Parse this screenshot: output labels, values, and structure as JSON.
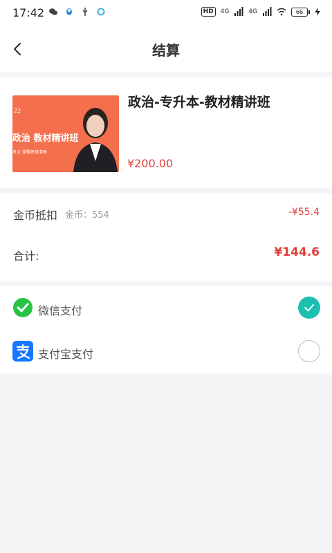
{
  "statusbar": {
    "time": "17:42",
    "left_icons": [
      "wechat-icon",
      "qq-icon",
      "usb-icon",
      "sync-icon"
    ],
    "hd_label": "HD",
    "net1": "4G",
    "net2": "4G",
    "battery": "66"
  },
  "navbar": {
    "back_icon": "chevron-left-icon",
    "title": "结算"
  },
  "product": {
    "cover_number": "22",
    "cover_title": "政治 教材精讲班",
    "cover_subtitle": "考点  逻辑思维清晰",
    "title": "政治-专升本-教材精讲班",
    "price": "¥200.00"
  },
  "deduction": {
    "label": "金币抵扣",
    "coins_text": "金币：554",
    "value": "-¥55.4"
  },
  "total": {
    "label": "合计:",
    "value": "¥144.6"
  },
  "payments": [
    {
      "label": "微信支付",
      "icon": "wechat-pay-icon",
      "selected": true
    },
    {
      "label": "支付宝支付",
      "icon": "alipay-icon",
      "selected": false
    }
  ],
  "colors": {
    "accent_price": "#e0403a",
    "selected_radio": "#1dbfae",
    "wechat_green": "#28c445",
    "alipay_blue": "#1677ff",
    "cover_bg": "#f36f4d"
  }
}
